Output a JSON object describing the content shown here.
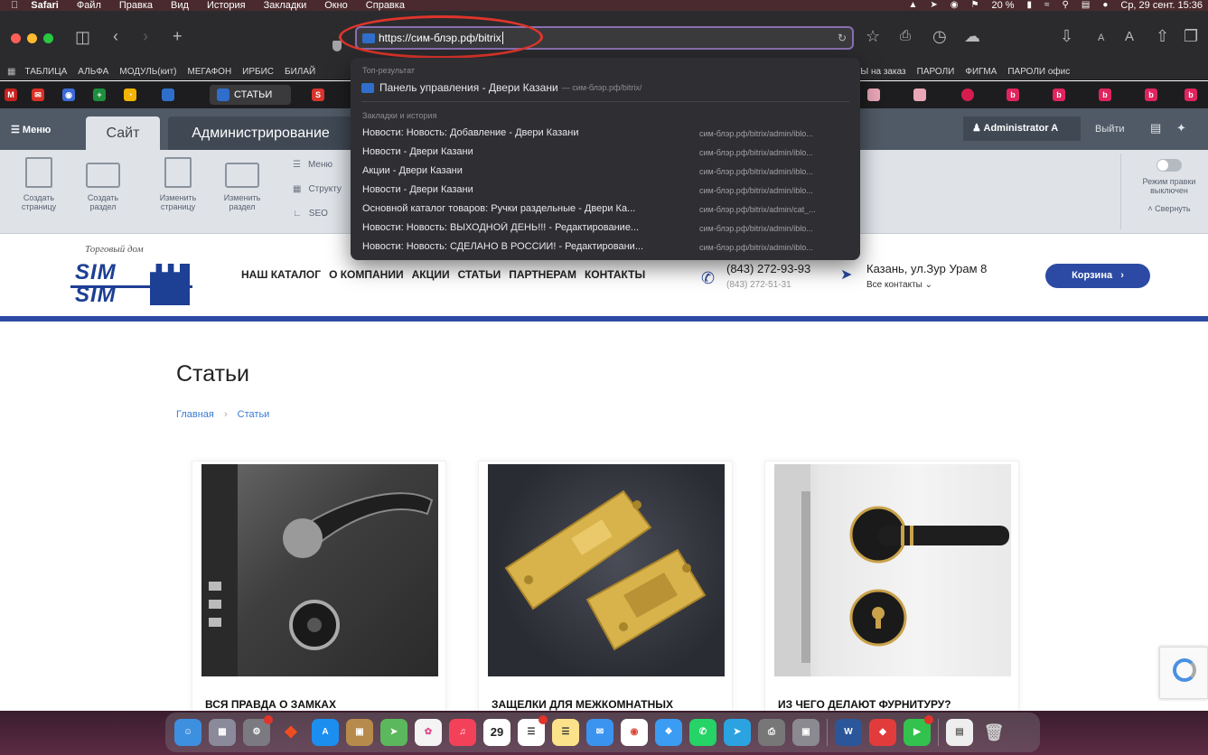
{
  "menubar": {
    "app": "Safari",
    "items": [
      "Файл",
      "Правка",
      "Вид",
      "История",
      "Закладки",
      "Окно",
      "Справка"
    ],
    "battery": "20 %",
    "datetime": "Ср, 29 сент.  15:36"
  },
  "toolbar": {
    "url": "https://сим-блэр.рф/bitrix"
  },
  "bookmarks": [
    "ТАБЛИЦА",
    "АЛЬФА",
    "МОДУЛЬ(кит)",
    "МЕГАФОН",
    "ИРБИС",
    "БИЛАЙ",
    "S",
    "ТЕКСТЫ на заказ",
    "ПАРОЛИ",
    "ФИГМА",
    "ПАРОЛИ офис"
  ],
  "tabs": {
    "active_label": "СТАТЬИ"
  },
  "dropdown": {
    "top_header": "Топ-результат",
    "top_title": "Панель управления - Двери Казани",
    "top_url": "— сим-блэр.рф/bitrix/",
    "history_header": "Закладки и история",
    "rows": [
      {
        "title": "Новости: Новость: Добавление - Двери Казани",
        "url": "сим-блэр.рф/bitrix/admin/iblo..."
      },
      {
        "title": "Новости - Двери Казани",
        "url": "сим-блэр.рф/bitrix/admin/iblo..."
      },
      {
        "title": "Акции - Двери Казани",
        "url": "сим-блэр.рф/bitrix/admin/iblo..."
      },
      {
        "title": "Новости - Двери Казани",
        "url": "сим-блэр.рф/bitrix/admin/iblo..."
      },
      {
        "title": "Основной каталог товаров: Ручки раздельные - Двери Ка...",
        "url": "сим-блэр.рф/bitrix/admin/cat_..."
      },
      {
        "title": "Новости: Новость: ВЫХОДНОЙ ДЕНЬ!!! - Редактирование...",
        "url": "сим-блэр.рф/bitrix/admin/iblo..."
      },
      {
        "title": "Новости: Новость: СДЕЛАНО В РОССИИ! - Редактировани...",
        "url": "сим-блэр.рф/bitrix/admin/iblo..."
      }
    ]
  },
  "bitrix": {
    "menu": "Меню",
    "tab_site": "Сайт",
    "tab_admin": "Администрирование",
    "user": "Administrator A",
    "logout": "Выйти",
    "tools": [
      {
        "label": "Создать страницу"
      },
      {
        "label": "Создать раздел"
      },
      {
        "label": "Изменить страницу"
      },
      {
        "label": "Изменить раздел"
      }
    ],
    "list": [
      "Меню",
      "Структу",
      "SEO"
    ],
    "edit_mode": "Режим правки выключен",
    "collapse": "Свернуть"
  },
  "site": {
    "logo_tagline": "Торговый дом",
    "logo_word": "SIM",
    "nav": [
      "НАШ КАТАЛОГ",
      "О КОМПАНИИ",
      "АКЦИИ",
      "СТАТЬИ",
      "ПАРТНЕРАМ",
      "КОНТАКТЫ"
    ],
    "phone1": "(843) 272-93-93",
    "phone2": "(843) 272-51-31",
    "address": "Казань, ул.Зур Урам 8",
    "contacts": "Все контакты",
    "cart": "Корзина"
  },
  "content": {
    "title": "Статьи",
    "breadcrumb_home": "Главная",
    "breadcrumb_current": "Статьи",
    "cards": [
      {
        "title": "ВСЯ ПРАВДА О ЗАМКАХ"
      },
      {
        "title": "ЗАЩЕЛКИ ДЛЯ МЕЖКОМНАТНЫХ"
      },
      {
        "title": "ИЗ ЧЕГО ДЕЛАЮТ ФУРНИТУРУ?"
      }
    ]
  },
  "dock": {
    "calendar_day": "29"
  },
  "colors": {
    "brand_blue": "#2c4aa3",
    "bitrix_panel": "#505a66",
    "highlight_ellipse": "#e0352b"
  }
}
